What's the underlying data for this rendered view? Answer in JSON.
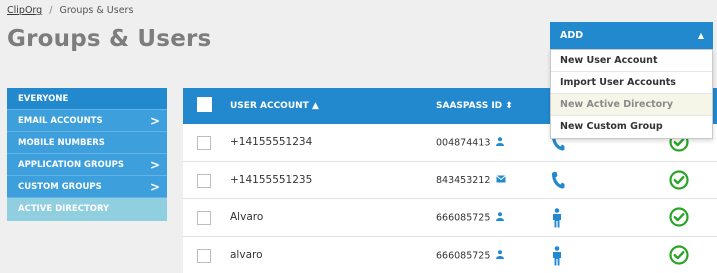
{
  "breadcrumb": {
    "root": "ClipOrg",
    "separator": "/",
    "current": "Groups & Users"
  },
  "page": {
    "title": "Groups & Users"
  },
  "sidebar": {
    "items": [
      {
        "label": "EVERYONE"
      },
      {
        "label": "EMAIL ACCOUNTS",
        "chevron": ">"
      },
      {
        "label": "MOBILE NUMBERS"
      },
      {
        "label": "APPLICATION GROUPS",
        "chevron": ">"
      },
      {
        "label": "CUSTOM GROUPS",
        "chevron": ">"
      },
      {
        "label": "ACTIVE DIRECTORY"
      }
    ]
  },
  "table": {
    "headers": {
      "user_account": "USER ACCOUNT",
      "user_sort": "▲",
      "saaspass_id": "SAASPASS ID",
      "id_sort": "⬍"
    },
    "rows": [
      {
        "account": "+14155551234",
        "saaspass_id": "004874413",
        "id_icon": "person-icon",
        "type_icon": "phone-icon",
        "status_icon": "check-circle-icon"
      },
      {
        "account": "+14155551235",
        "saaspass_id": "843453212",
        "id_icon": "envelope-icon",
        "type_icon": "phone-icon",
        "status_icon": "check-circle-icon"
      },
      {
        "account": "Alvaro",
        "saaspass_id": "666085725",
        "id_icon": "person-icon",
        "type_icon": "standing-person-icon",
        "status_icon": "check-circle-icon"
      },
      {
        "account": "alvaro",
        "saaspass_id": "666085725",
        "id_icon": "person-icon",
        "type_icon": "standing-person-icon",
        "status_icon": "check-circle-icon"
      }
    ]
  },
  "add_menu": {
    "button_label": "ADD",
    "caret": "▲",
    "items": [
      {
        "label": "New User Account"
      },
      {
        "label": "Import User Accounts"
      },
      {
        "label": "New Active Directory"
      },
      {
        "label": "New Custom Group"
      }
    ]
  },
  "colors": {
    "primary": "#2389cf",
    "sidebar": "#3d9fdc",
    "active": "#8fcfe0",
    "success": "#2aa52a",
    "title": "#7d7d7d"
  }
}
